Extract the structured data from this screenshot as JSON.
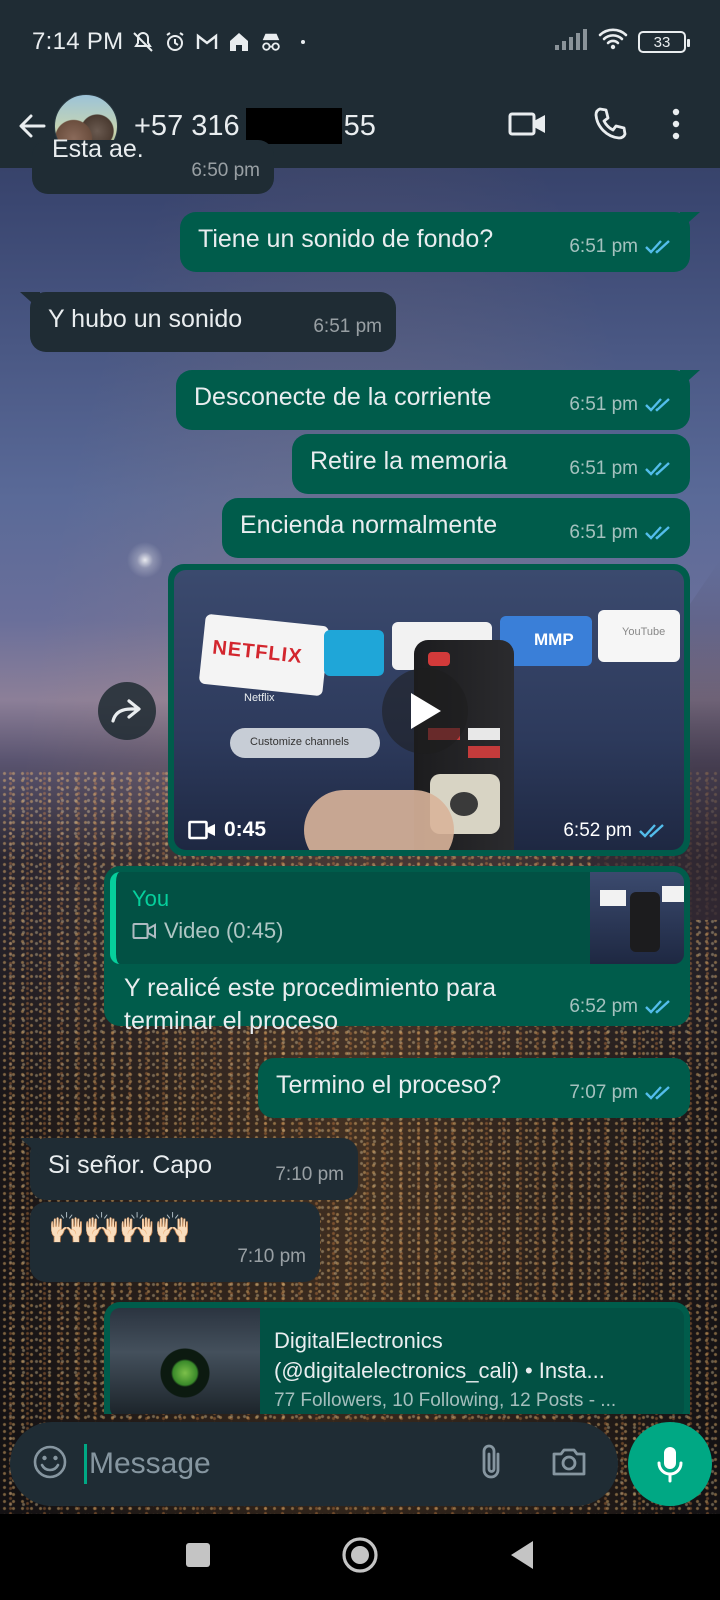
{
  "status_bar": {
    "time": "7:14 PM",
    "battery": "33",
    "icons": [
      "mute-notification-icon",
      "alarm-icon",
      "gmail-icon",
      "home-icon",
      "incognito-icon",
      "signal-icon",
      "wifi-icon",
      "battery-icon"
    ]
  },
  "header": {
    "contact_prefix": "+57 316",
    "contact_suffix": "55"
  },
  "messages": [
    {
      "id": "m0",
      "direction": "in",
      "text": "Esta ae.",
      "time": "6:50 pm"
    },
    {
      "id": "m1",
      "direction": "out",
      "text": "Tiene un sonido de fondo?",
      "time": "6:51 pm"
    },
    {
      "id": "m2",
      "direction": "in",
      "text": "Y hubo un sonido",
      "time": "6:51 pm"
    },
    {
      "id": "m3",
      "direction": "out",
      "text": "Desconecte de la corriente",
      "time": "6:51 pm"
    },
    {
      "id": "m4",
      "direction": "out",
      "text": "Retire la memoria",
      "time": "6:51 pm"
    },
    {
      "id": "m5",
      "direction": "out",
      "text": "Encienda normalmente",
      "time": "6:51 pm"
    }
  ],
  "video_message": {
    "duration": "0:45",
    "time": "6:52 pm",
    "tiles": [
      "NETFLIX",
      "Netflix",
      "Customize channels",
      "MMP",
      "YouTube"
    ]
  },
  "reply_message": {
    "quoted_author": "You",
    "quoted_text": "Video (0:45)",
    "text_line1": "Y realicé este procedimiento para",
    "text_line2": "terminar el proceso",
    "time": "6:52 pm"
  },
  "messages2": [
    {
      "id": "m6",
      "direction": "out",
      "text": "Termino el proceso?",
      "time": "7:07 pm"
    },
    {
      "id": "m7",
      "direction": "in",
      "text": "Si señor. Capo",
      "time": "7:10 pm"
    },
    {
      "id": "m8",
      "direction": "in",
      "text": "🙌🏻🙌🏻🙌🏻🙌🏻",
      "time": "7:10 pm"
    }
  ],
  "link_preview": {
    "title_line1": "DigitalElectronics",
    "title_line2": "(@digitalelectronics_cali) • Insta...",
    "subtitle": "77 Followers, 10 Following, 12 Posts - ..."
  },
  "input": {
    "placeholder": "Message"
  },
  "colors": {
    "outgoing_bubble": "#005c4b",
    "incoming_bubble": "#1f2c34",
    "accent": "#00a884",
    "read_ticks": "#53bdeb"
  }
}
